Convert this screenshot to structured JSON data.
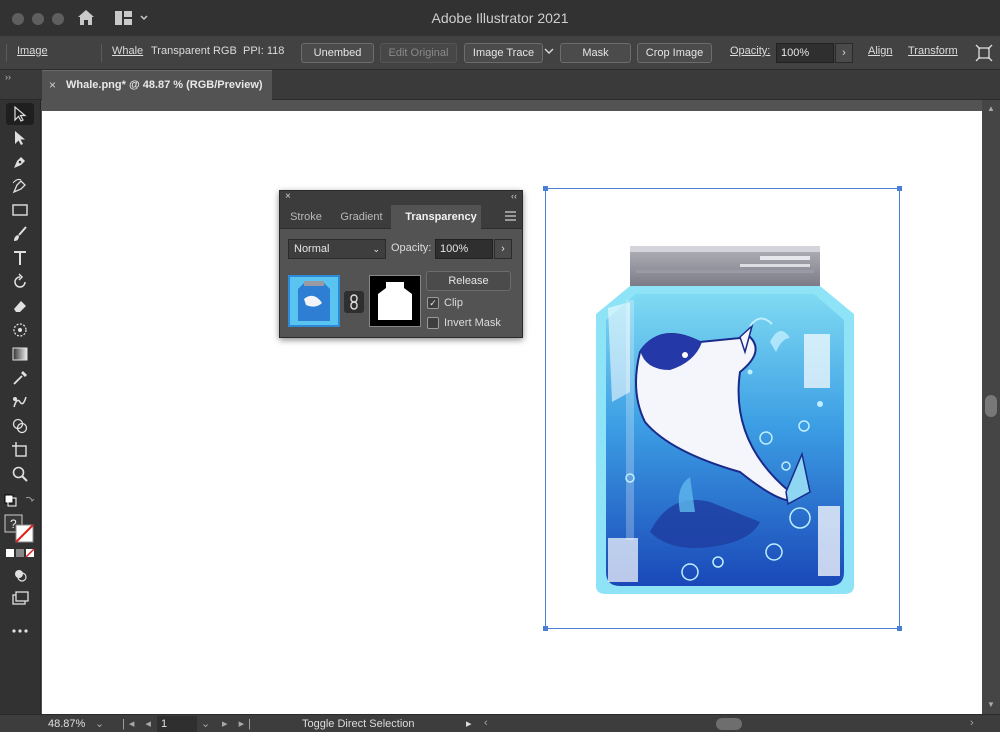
{
  "app": {
    "title": "Adobe Illustrator 2021"
  },
  "control_bar": {
    "object_type": "Image",
    "file_name": "Whale",
    "color_mode": "Transparent RGB",
    "ppi": "PPI: 118",
    "unembed": "Unembed",
    "edit_original": "Edit Original",
    "image_trace": "Image Trace",
    "mask": "Mask",
    "crop_image": "Crop Image",
    "opacity_label": "Opacity:",
    "opacity_value": "100%",
    "align": "Align",
    "transform": "Transform"
  },
  "document_tab": {
    "label": "Whale.png* @ 48.87 % (RGB/Preview)",
    "close": "×"
  },
  "transparency_panel": {
    "tabs": [
      "Stroke",
      "Gradient",
      "Transparency"
    ],
    "active_tab": "Transparency",
    "blend_mode": "Normal",
    "opacity_label": "Opacity:",
    "opacity_value": "100%",
    "release": "Release",
    "clip_label": "Clip",
    "clip_checked": true,
    "invert_mask_label": "Invert Mask",
    "invert_mask_checked": false
  },
  "status_bar": {
    "zoom": "48.87%",
    "page": "1",
    "status_text": "Toggle Direct Selection"
  },
  "colors": {
    "selection": "#4a7fd6",
    "jar_light": "#7fdaf2",
    "jar_dark": "#1a48b8",
    "lid": "#8c8c96"
  }
}
